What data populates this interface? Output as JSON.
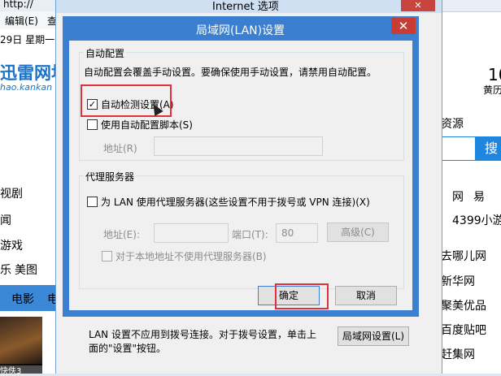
{
  "background": {
    "address_fragment": "http://",
    "menu_items": [
      "编辑(E)",
      "查"
    ],
    "date": "29日 星期一 (",
    "logo": "迅雷网址",
    "logo_url": "hao.kankan",
    "left_links": [
      "视剧",
      "闻",
      "游戏",
      "乐",
      "美图"
    ],
    "nav_items": [
      "电影",
      "电"
    ],
    "movie_caption": "快佚3",
    "right_items": [
      "10",
      "黄历",
      "资源",
      "搜",
      "网",
      "易",
      "4399小游",
      "去哪儿网",
      "新华网",
      "聚美优品",
      "百度贴吧",
      "赶集网"
    ]
  },
  "internet_options": {
    "title": "Internet 选项",
    "close_icon": "close-icon",
    "lan_note": "LAN 设置不应用到拨号连接。对于拨号设置，单击上面的\"设置\"按钮。",
    "lan_settings_button": "局域网设置(L)"
  },
  "lan_dialog": {
    "title": "局域网(LAN)设置",
    "auto_config": {
      "legend": "自动配置",
      "description": "自动配置会覆盖手动设置。要确保使用手动设置，请禁用自动配置。",
      "auto_detect_label": "自动检测设置(A)",
      "auto_detect_checked": true,
      "use_script_label": "使用自动配置脚本(S)",
      "use_script_checked": false,
      "address_label": "地址(R)",
      "address_value": ""
    },
    "proxy": {
      "legend": "代理服务器",
      "use_proxy_label": "为 LAN 使用代理服务器(这些设置不用于拨号或 VPN 连接)(X)",
      "use_proxy_checked": false,
      "address_label": "地址(E):",
      "address_value": "",
      "port_label": "端口(T):",
      "port_value": "80",
      "advanced_button": "高级(C)",
      "bypass_label": "对于本地地址不使用代理服务器(B)",
      "bypass_checked": false
    },
    "ok_button": "确定",
    "cancel_button": "取消"
  },
  "colors": {
    "dialog_border": "#3b7fd0",
    "highlight": "#e0303a",
    "close_red": "#c73d35"
  }
}
